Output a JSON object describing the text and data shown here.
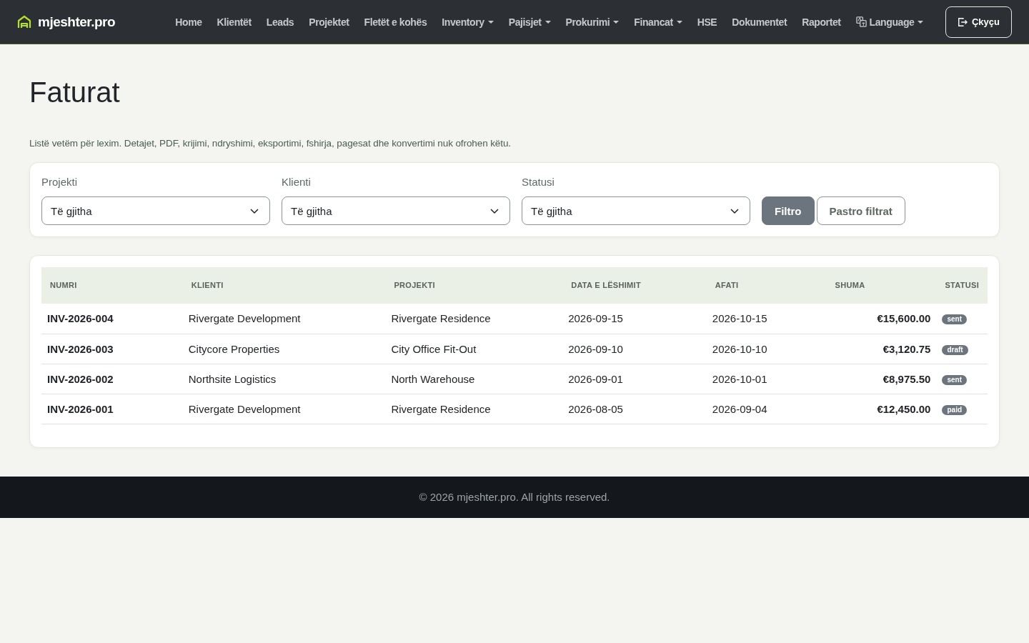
{
  "brand": {
    "name": "mjeshter.pro"
  },
  "nav": [
    {
      "label": "Home",
      "dropdown": false
    },
    {
      "label": "Klientët",
      "dropdown": false
    },
    {
      "label": "Leads",
      "dropdown": false
    },
    {
      "label": "Projektet",
      "dropdown": false
    },
    {
      "label": "Fletët e kohës",
      "dropdown": false
    },
    {
      "label": "Inventory",
      "dropdown": true
    },
    {
      "label": "Pajisjet",
      "dropdown": true
    },
    {
      "label": "Prokurimi",
      "dropdown": true
    },
    {
      "label": "Financat",
      "dropdown": true
    },
    {
      "label": "HSE",
      "dropdown": false
    },
    {
      "label": "Dokumentet",
      "dropdown": false
    },
    {
      "label": "Raportet",
      "dropdown": false
    },
    {
      "label": "Language",
      "dropdown": true,
      "kind": "language"
    }
  ],
  "logout": {
    "label": "Çkyçu"
  },
  "page": {
    "title": "Faturat",
    "note": "Listë vetëm për lexim. Detajet, PDF, krijimi, ndryshimi, eksportimi, fshirja, pagesat dhe konvertimi nuk ofrohen këtu."
  },
  "filters": [
    {
      "label": "Projekti",
      "value": "Të gjitha"
    },
    {
      "label": "Klienti",
      "value": "Të gjitha"
    },
    {
      "label": "Statusi",
      "value": "Të gjitha"
    }
  ],
  "filter_buttons": [
    {
      "label": "Filtro",
      "kind": "primary"
    },
    {
      "label": "Pastro filtrat",
      "kind": "outline"
    }
  ],
  "table": {
    "columns": [
      "NUMRI",
      "KLIENTI",
      "PROJEKTI",
      "DATA E LËSHIMIT",
      "AFATI",
      "SHUMA",
      "STATUSI"
    ],
    "rows": [
      {
        "number": "INV-2026-004",
        "client": "Rivergate Development",
        "project": "Rivergate Residence",
        "issued": "2026-09-15",
        "due": "2026-10-15",
        "amount": "€15,600.00",
        "status": "sent"
      },
      {
        "number": "INV-2026-003",
        "client": "Citycore Properties",
        "project": "City Office Fit-Out",
        "issued": "2026-09-10",
        "due": "2026-10-10",
        "amount": "€3,120.75",
        "status": "draft"
      },
      {
        "number": "INV-2026-002",
        "client": "Northsite Logistics",
        "project": "North Warehouse",
        "issued": "2026-09-01",
        "due": "2026-10-01",
        "amount": "€8,975.50",
        "status": "sent"
      },
      {
        "number": "INV-2026-001",
        "client": "Rivergate Development",
        "project": "Rivergate Residence",
        "issued": "2026-08-05",
        "due": "2026-09-04",
        "amount": "€12,450.00",
        "status": "paid"
      }
    ]
  },
  "footer": {
    "text": "© 2026 mjeshter.pro. All rights reserved."
  }
}
